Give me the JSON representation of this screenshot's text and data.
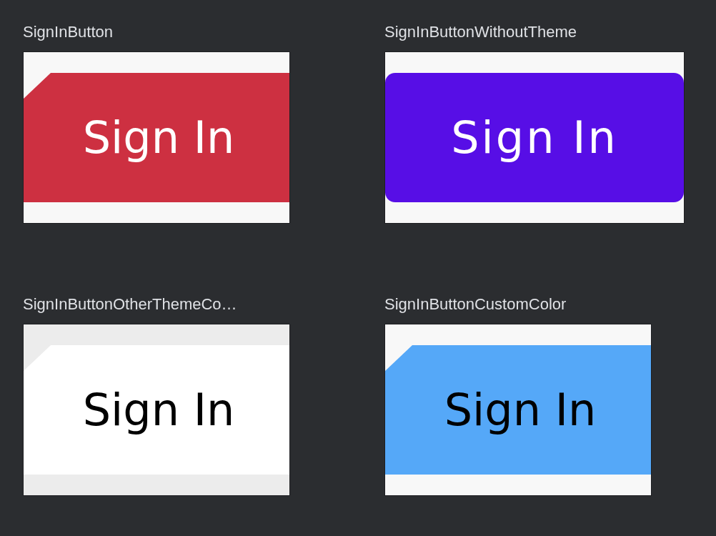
{
  "previews": [
    {
      "title": "SignInButton",
      "kind": "cut",
      "button": {
        "label": "Sign In",
        "color": "#cd3041",
        "kind": "light"
      }
    },
    {
      "title": "SignInButtonWithoutTheme",
      "kind": "rounded",
      "button": {
        "label": "Sign In",
        "color": "#570ee6",
        "kind": "light"
      }
    },
    {
      "title": "SignInButtonOtherThemeCo…",
      "kind": "cut-elevated",
      "button": {
        "label": "Sign In",
        "color": "#ffffff",
        "kind": "dark"
      }
    },
    {
      "title": "SignInButtonCustomColor",
      "kind": "cut",
      "button": {
        "label": "Sign In",
        "color": "#55a8f8",
        "kind": "dark"
      }
    }
  ]
}
